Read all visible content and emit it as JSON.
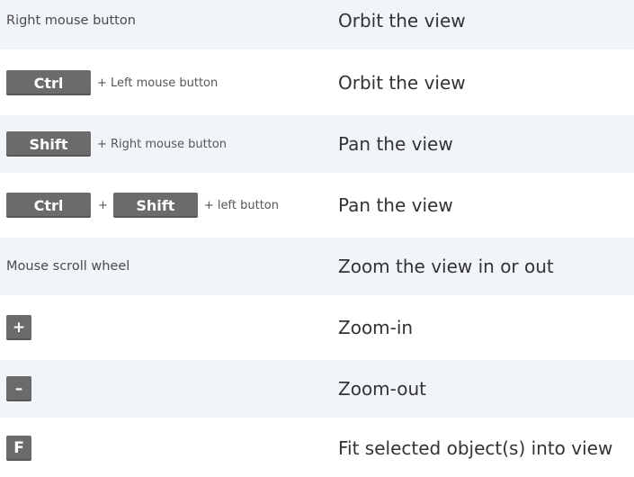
{
  "rows": [
    {
      "left_text": "Right mouse button",
      "action": "Orbit the view"
    },
    {
      "key1": "Ctrl",
      "joiner": "+ Left mouse button",
      "action": "Orbit the view"
    },
    {
      "key1": "Shift",
      "joiner": "+ Right mouse button",
      "action": "Pan the view"
    },
    {
      "key1": "Ctrl",
      "mid_plus": "+",
      "key2": "Shift",
      "joiner": "+ left button",
      "action": "Pan the view"
    },
    {
      "left_text": "Mouse scroll wheel",
      "action": "Zoom the view in or out"
    },
    {
      "key1": "+",
      "action": "Zoom-in"
    },
    {
      "key1": "–",
      "action": "Zoom-out"
    },
    {
      "key1": "F",
      "action": "Fit selected object(s) into view"
    }
  ],
  "colors": {
    "row_shade": "#f1f5f9",
    "key_bg": "#6b6b6b",
    "key_text": "#ffffff"
  }
}
